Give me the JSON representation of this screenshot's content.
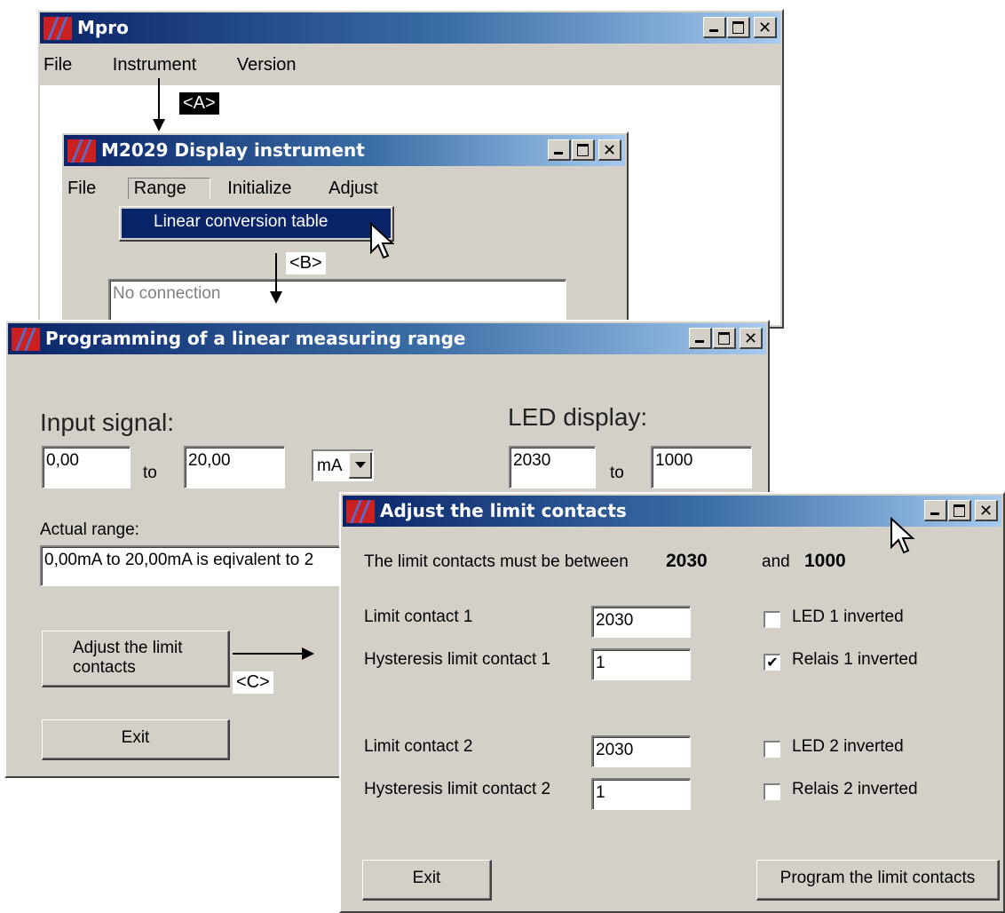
{
  "main_window": {
    "title": "Mpro",
    "menu": [
      "File",
      "Instrument",
      "Version"
    ]
  },
  "display_window": {
    "title": "M2029 Display instrument",
    "menu": [
      "File",
      "Range",
      "Initialize",
      "Adjust"
    ],
    "dropdown_item": "Linear conversion table",
    "status_text": "No connection"
  },
  "range_window": {
    "title": "Programming of a linear measuring range",
    "input_signal_label": "Input signal:",
    "input_from": "0,00",
    "to_label_1": "to",
    "input_to": "20,00",
    "unit_selected": "mA",
    "led_display_label": "LED display:",
    "led_from": "2030",
    "to_label_2": "to",
    "led_to": "1000",
    "actual_range_label": "Actual range:",
    "actual_range_value": "0,00mA to 20,00mA is eqivalent to 2",
    "adjust_button_line1": "Adjust the limit",
    "adjust_button_line2": "contacts",
    "exit_button": "Exit"
  },
  "limit_window": {
    "title": "Adjust the limit contacts",
    "info_prefix": "The limit contacts must be between",
    "info_low": "2030",
    "info_and": "and",
    "info_high": "1000",
    "limit1_label": "Limit contact 1",
    "limit1_value": "2030",
    "hyst1_label": "Hysteresis limit contact 1",
    "hyst1_value": "1",
    "limit2_label": "Limit contact 2",
    "limit2_value": "2030",
    "hyst2_label": "Hysteresis limit contact 2",
    "hyst2_value": "1",
    "led1_label": "LED 1 inverted",
    "led1_checked": false,
    "relais1_label": "Relais 1 inverted",
    "relais1_checked": true,
    "led2_label": "LED 2 inverted",
    "led2_checked": false,
    "relais2_label": "Relais 2 inverted",
    "relais2_checked": false,
    "exit_button": "Exit",
    "program_button": "Program the limit contacts"
  },
  "annotations": {
    "a": "<A>",
    "b": "<B>",
    "c": "<C>"
  },
  "colors": {
    "title_start": "#0a246a",
    "title_end": "#a6caf0",
    "window_face": "#d4d0c8",
    "menu_highlight": "#0a246a"
  }
}
